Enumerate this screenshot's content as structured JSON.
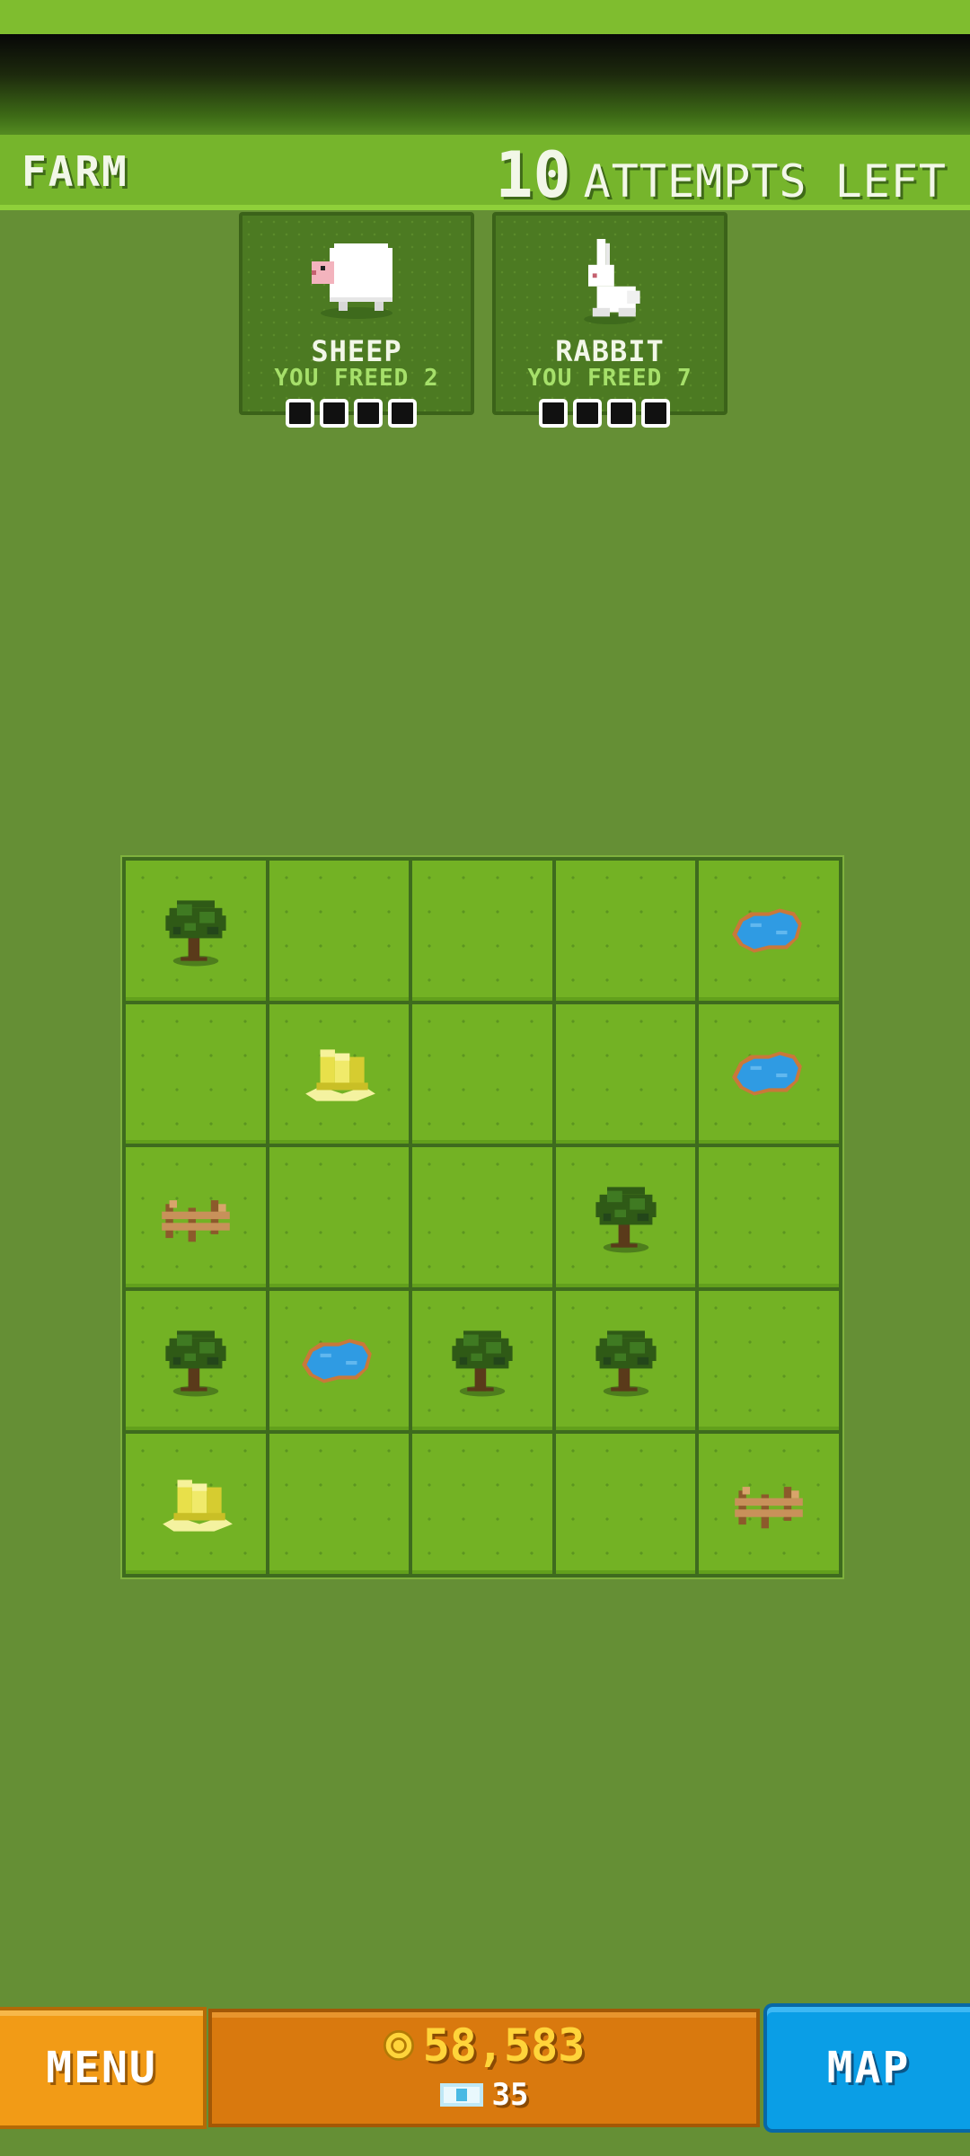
{
  "header": {
    "title": "FARM",
    "attempts_number": "10",
    "attempts_label": "ATTEMPTS LEFT"
  },
  "animals": [
    {
      "name": "SHEEP",
      "freed": "YOU FREED 2",
      "icon": "sheep-icon"
    },
    {
      "name": "RABBIT",
      "freed": "YOU FREED 7",
      "icon": "rabbit-icon"
    }
  ],
  "grid": {
    "rows": [
      [
        "tree",
        "empty",
        "empty",
        "empty",
        "pond"
      ],
      [
        "empty",
        "hay",
        "empty",
        "empty",
        "pond"
      ],
      [
        "fence",
        "empty",
        "empty",
        "tree",
        "empty"
      ],
      [
        "tree",
        "pond",
        "tree",
        "tree",
        "empty"
      ],
      [
        "hay",
        "empty",
        "empty",
        "empty",
        "fence"
      ]
    ]
  },
  "footer": {
    "menu_label": "MENU",
    "coins": "58,583",
    "gems": "35",
    "map_label": "MAP"
  },
  "colors": {
    "grass": "#73b224",
    "background": "#658f35",
    "menu": "#f29b16",
    "map": "#0a9ee6",
    "wallet": "#d9790e"
  }
}
